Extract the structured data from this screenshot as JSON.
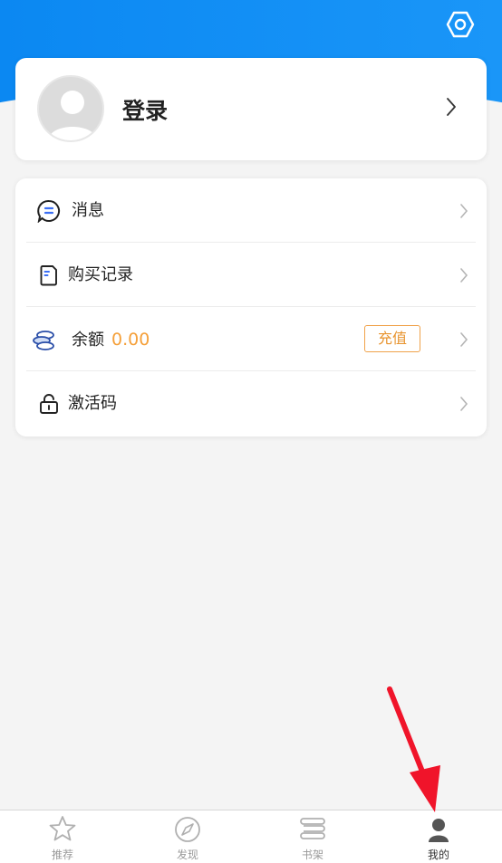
{
  "header": {
    "settings_icon": "hexagon-settings-icon",
    "gradient_start": "#0b88f2",
    "gradient_end": "#1a96f8"
  },
  "profile": {
    "login_label": "登录",
    "avatar_icon": "default-avatar-icon"
  },
  "menu": {
    "messages": {
      "label": "消息",
      "icon": "message-icon"
    },
    "purchases": {
      "label": "购买记录",
      "icon": "document-icon"
    },
    "balance": {
      "label": "余额",
      "value": "0.00",
      "recharge_label": "充值",
      "icon": "coins-icon"
    },
    "activation": {
      "label": "激活码",
      "icon": "lock-icon"
    }
  },
  "tabbar": {
    "tabs": [
      {
        "label": "推荐",
        "icon": "star-icon",
        "active": false
      },
      {
        "label": "发现",
        "icon": "compass-icon",
        "active": false
      },
      {
        "label": "书架",
        "icon": "bookshelf-icon",
        "active": false
      },
      {
        "label": "我的",
        "icon": "person-icon",
        "active": true
      }
    ]
  },
  "colors": {
    "accent_orange": "#f5a03a",
    "annotation_arrow": "#f0142a"
  }
}
